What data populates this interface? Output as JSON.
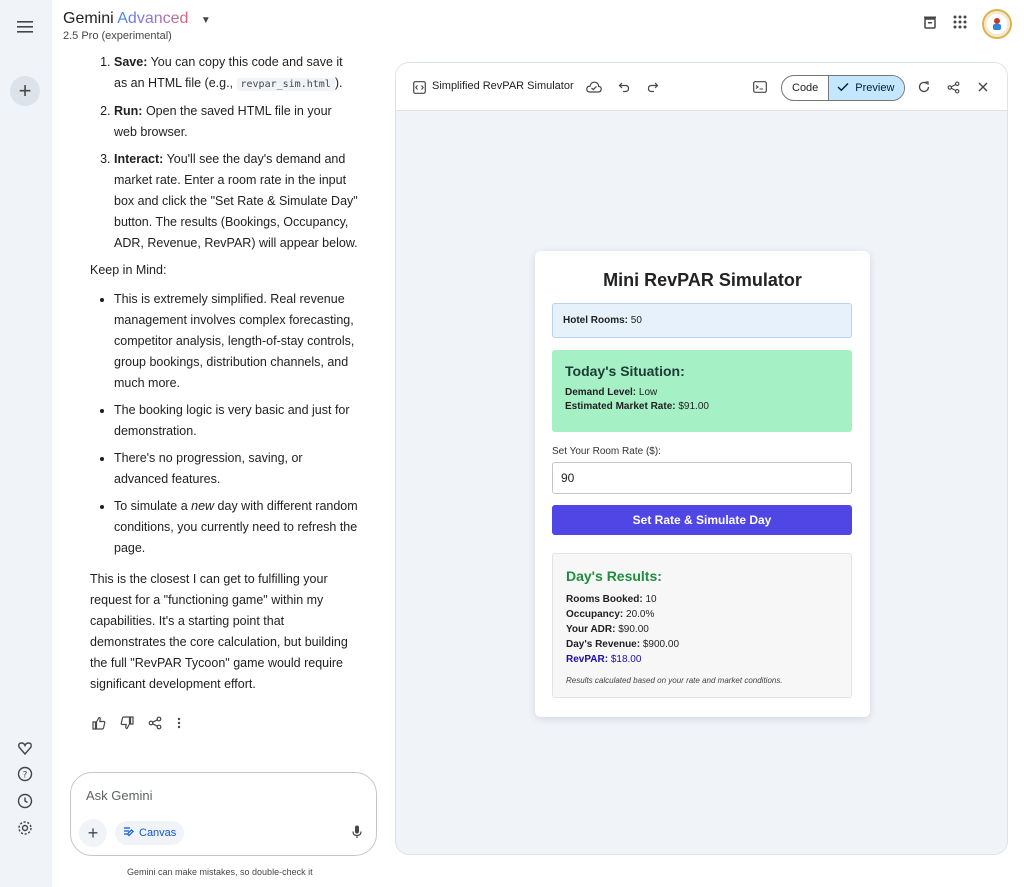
{
  "app": {
    "title_prefix": "Gemini",
    "title_advanced": "Advanced",
    "model": "2.5 Pro (experimental)"
  },
  "chat": {
    "steps": [
      {
        "bold": "Save:",
        "text": " You can copy this code and save it as an HTML file (e.g., ",
        "code": "revpar_sim.html",
        "after": ")."
      },
      {
        "bold": "Run:",
        "text": " Open the saved HTML file in your web browser."
      },
      {
        "bold": "Interact:",
        "text": " You'll see the day's demand and market rate. Enter a room rate in the input box and click the \"Set Rate & Simulate Day\" button. The results (Bookings, Occupancy, ADR, Revenue, RevPAR) will appear below."
      }
    ],
    "keep_heading": "Keep in Mind:",
    "bullets": [
      "This is extremely simplified. Real revenue management involves complex forecasting, competitor analysis, length-of-stay controls, group bookings, distribution channels, and much more.",
      "The booking logic is very basic and just for demonstration.",
      "There's no progression, saving, or advanced features."
    ],
    "last_bullet": {
      "before": "To simulate a ",
      "em": "new",
      "after": " day with different random conditions, you currently need to refresh the page."
    },
    "closing": "This is the closest I can get to fulfilling your request for a \"functioning game\" within my capabilities. It's a starting point that demonstrates the core calculation, but building the full \"RevPAR Tycoon\" game would require significant development effort."
  },
  "prompt": {
    "placeholder": "Ask Gemini",
    "canvas_label": "Canvas",
    "disclaimer": "Gemini can make mistakes, so double-check it"
  },
  "panel": {
    "title": "Simplified RevPAR Simulator",
    "code_label": "Code",
    "preview_label": "Preview"
  },
  "sim": {
    "title": "Mini RevPAR Simulator",
    "hotel_label": "Hotel Rooms:",
    "hotel_value": " 50",
    "situation_heading": "Today's Situation:",
    "demand_label": "Demand Level:",
    "demand_value": " Low",
    "market_label": "Estimated Market Rate:",
    "market_value": " $91.00",
    "rate_label": "Set Your Room Rate ($):",
    "rate_value": "90",
    "button_label": "Set Rate & Simulate Day",
    "results_heading": "Day's Results:",
    "results": [
      {
        "label": "Rooms Booked:",
        "value": " 10"
      },
      {
        "label": "Occupancy:",
        "value": " 20.0%"
      },
      {
        "label": "Your ADR:",
        "value": " $90.00"
      },
      {
        "label": "Day's Revenue:",
        "value": " $900.00"
      }
    ],
    "revpar_label": "RevPAR:",
    "revpar_value": " $18.00",
    "note": "Results calculated based on your rate and market conditions."
  },
  "colors": {
    "accent_button": "#4f46e5",
    "situation_bg": "#a6f0c6",
    "results_heading": "#1e8e3e",
    "revpar": "#1a0dab"
  }
}
